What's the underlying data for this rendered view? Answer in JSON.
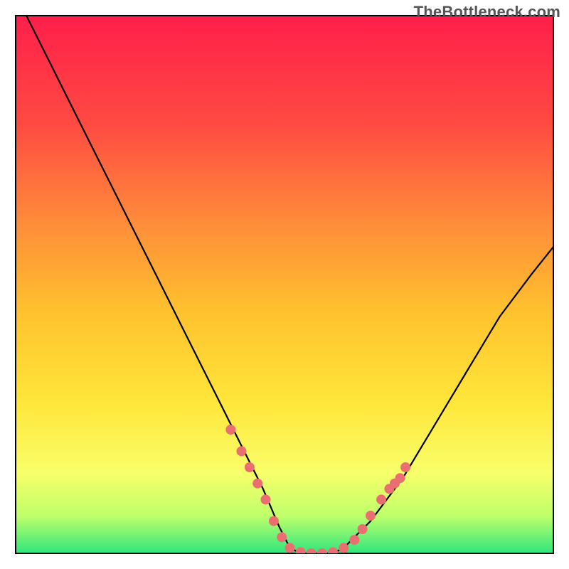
{
  "watermark": {
    "text": "TheBottleneck.com"
  },
  "chart_data": {
    "type": "line",
    "title": "",
    "xlabel": "",
    "ylabel": "",
    "xlim": [
      0,
      100
    ],
    "ylim": [
      0,
      100
    ],
    "series": [
      {
        "name": "bottleneck-curve",
        "x": [
          2,
          6,
          10,
          14,
          18,
          22,
          26,
          30,
          34,
          38,
          42,
          46,
          49,
          51,
          53,
          55,
          57,
          59,
          61,
          66,
          72,
          78,
          84,
          90,
          96,
          100
        ],
        "y": [
          100,
          92,
          84,
          76,
          68,
          60,
          52,
          44,
          36,
          28,
          20,
          12,
          5,
          1,
          0,
          0,
          0,
          0,
          1,
          6,
          14,
          24,
          34,
          44,
          52,
          57
        ]
      }
    ],
    "highlight_points": {
      "name": "marked-range",
      "points": [
        {
          "x": 40,
          "y": 23
        },
        {
          "x": 42,
          "y": 19
        },
        {
          "x": 43.5,
          "y": 16
        },
        {
          "x": 45,
          "y": 13
        },
        {
          "x": 46.5,
          "y": 10
        },
        {
          "x": 48,
          "y": 6
        },
        {
          "x": 49.5,
          "y": 3
        },
        {
          "x": 51,
          "y": 1
        },
        {
          "x": 53,
          "y": 0.2
        },
        {
          "x": 55,
          "y": 0
        },
        {
          "x": 57,
          "y": 0
        },
        {
          "x": 59,
          "y": 0.2
        },
        {
          "x": 61,
          "y": 1
        },
        {
          "x": 63,
          "y": 2.5
        },
        {
          "x": 64.5,
          "y": 4.5
        },
        {
          "x": 66,
          "y": 7
        },
        {
          "x": 68,
          "y": 10
        },
        {
          "x": 69.5,
          "y": 12
        },
        {
          "x": 70.5,
          "y": 13
        },
        {
          "x": 71.5,
          "y": 14
        },
        {
          "x": 72.5,
          "y": 16
        }
      ]
    },
    "colors": {
      "gradient_top": "#ff1f4b",
      "gradient_mid_upper": "#ff6a3d",
      "gradient_mid": "#ffd22e",
      "gradient_mid_lower": "#fff76a",
      "gradient_bottom": "#2fe67c",
      "dot": "#e96f71"
    }
  }
}
